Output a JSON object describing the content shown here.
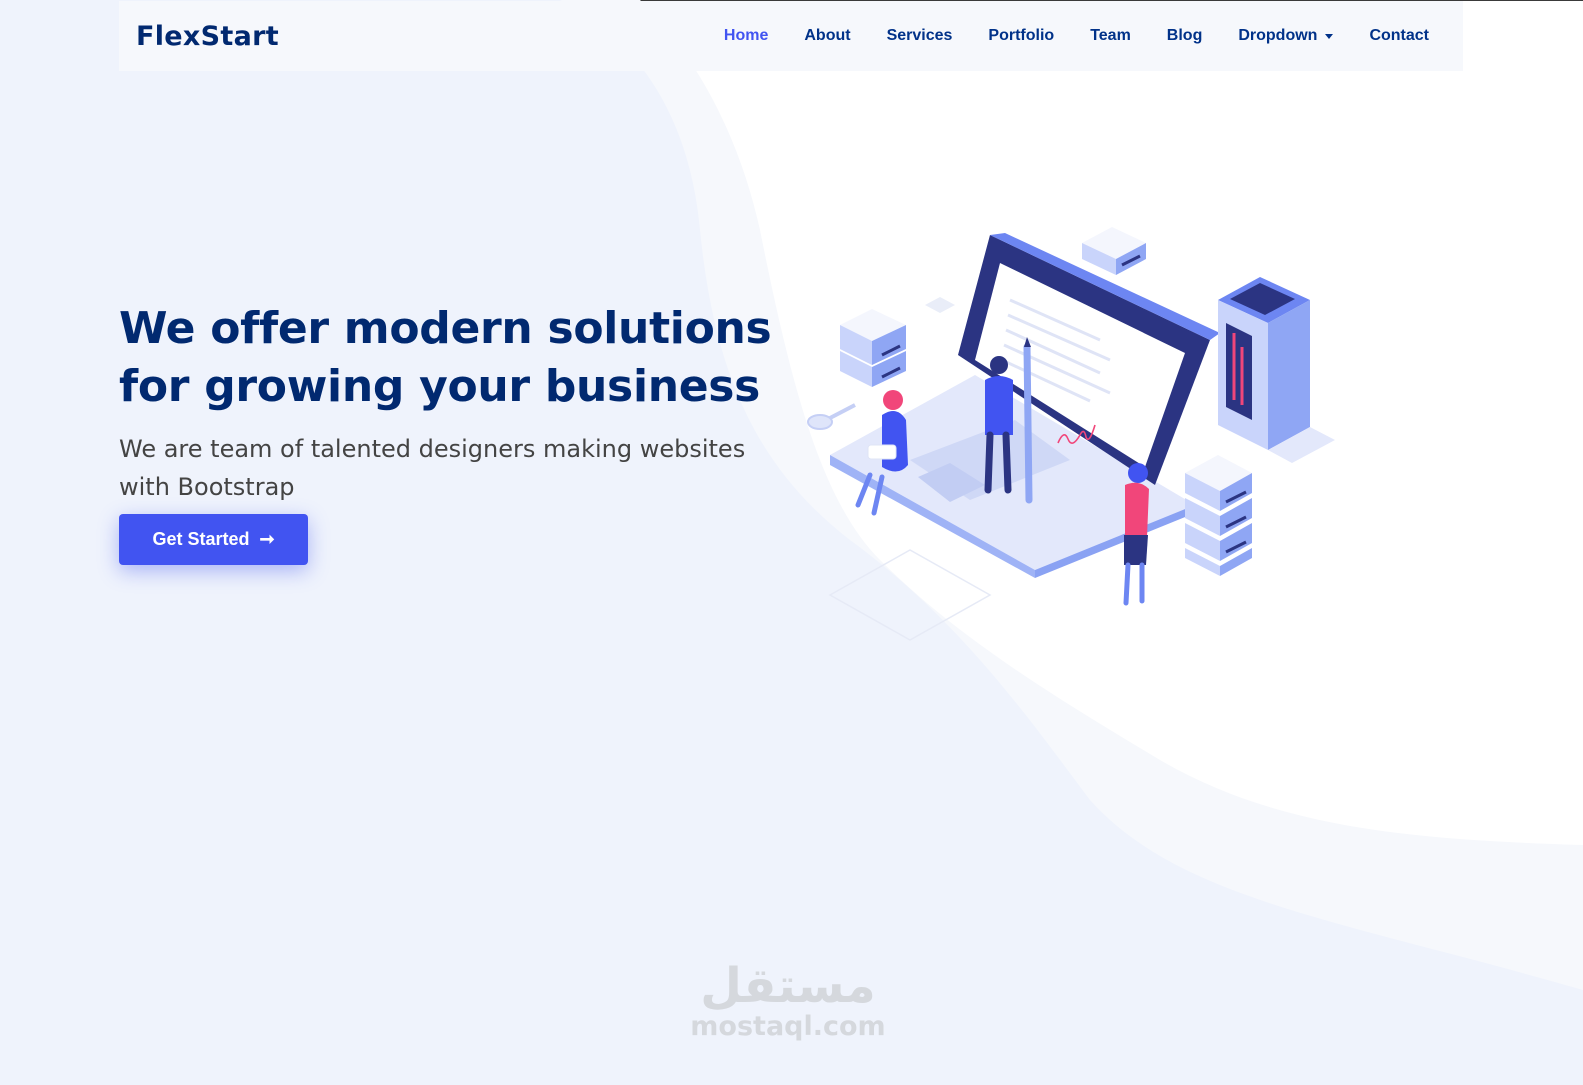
{
  "header": {
    "logo": "FlexStart",
    "nav": [
      {
        "label": "Home",
        "active": true
      },
      {
        "label": "About"
      },
      {
        "label": "Services"
      },
      {
        "label": "Portfolio"
      },
      {
        "label": "Team"
      },
      {
        "label": "Blog"
      },
      {
        "label": "Dropdown",
        "has_caret": true
      },
      {
        "label": "Contact"
      }
    ]
  },
  "hero": {
    "title_line1": "We offer modern solutions",
    "title_line2": "for growing your business",
    "subtitle": "We are team of talented designers making websites with Bootstrap",
    "cta_label": "Get Started",
    "cta_icon": "arrow-right-icon"
  },
  "watermark": {
    "arabic": "مستقل",
    "latin": "mostaql.com"
  },
  "colors": {
    "brand_dark": "#012970",
    "accent": "#4154f1",
    "pink": "#f1467a",
    "background_tint": "#f0f4fc"
  }
}
